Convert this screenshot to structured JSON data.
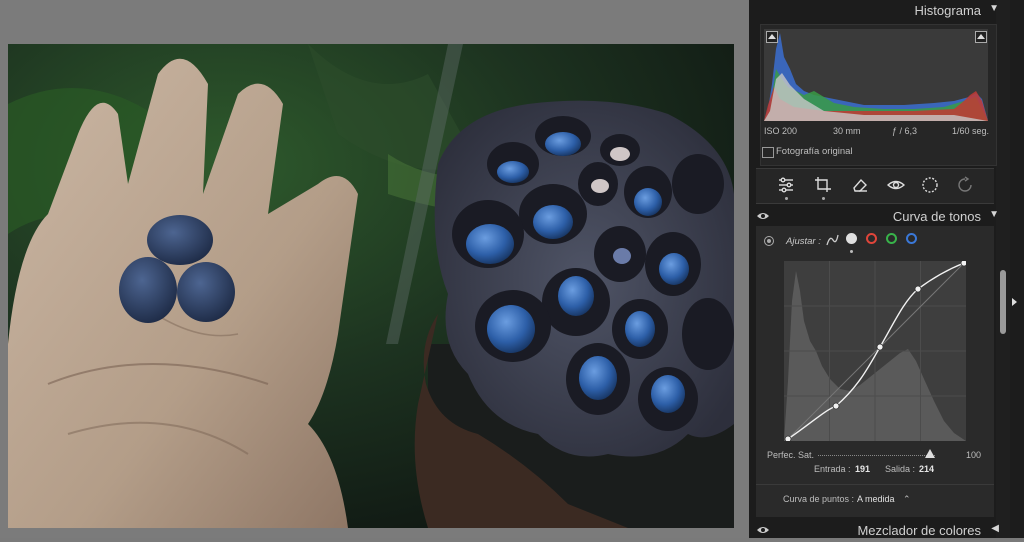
{
  "histogram": {
    "title": "Histograma",
    "iso": "ISO 200",
    "focal": "30 mm",
    "aperture": "ƒ / 6,3",
    "shutter": "1/60 seg.",
    "original_photo_label": "Fotografía original"
  },
  "tone_curve": {
    "title": "Curva de tonos",
    "adjust_label": "Ajustar :",
    "refine_sat_label": "Perfec. Sat.",
    "refine_sat_value": "100",
    "input_label": "Entrada :",
    "input_value": "191",
    "output_label": "Salida :",
    "output_value": "214",
    "point_curve_label": "Curva de puntos :",
    "point_curve_value": "A medida",
    "channel_colors": {
      "all": "#e0e0e0",
      "red": "#e0453a",
      "green": "#38b34a",
      "blue": "#3a78d8"
    }
  },
  "color_mixer": {
    "title": "Mezclador de colores"
  },
  "tools": {
    "icons": [
      "sliders-icon",
      "crop-icon",
      "eraser-icon",
      "red-eye-icon",
      "mask-icon",
      "history-icon"
    ]
  }
}
